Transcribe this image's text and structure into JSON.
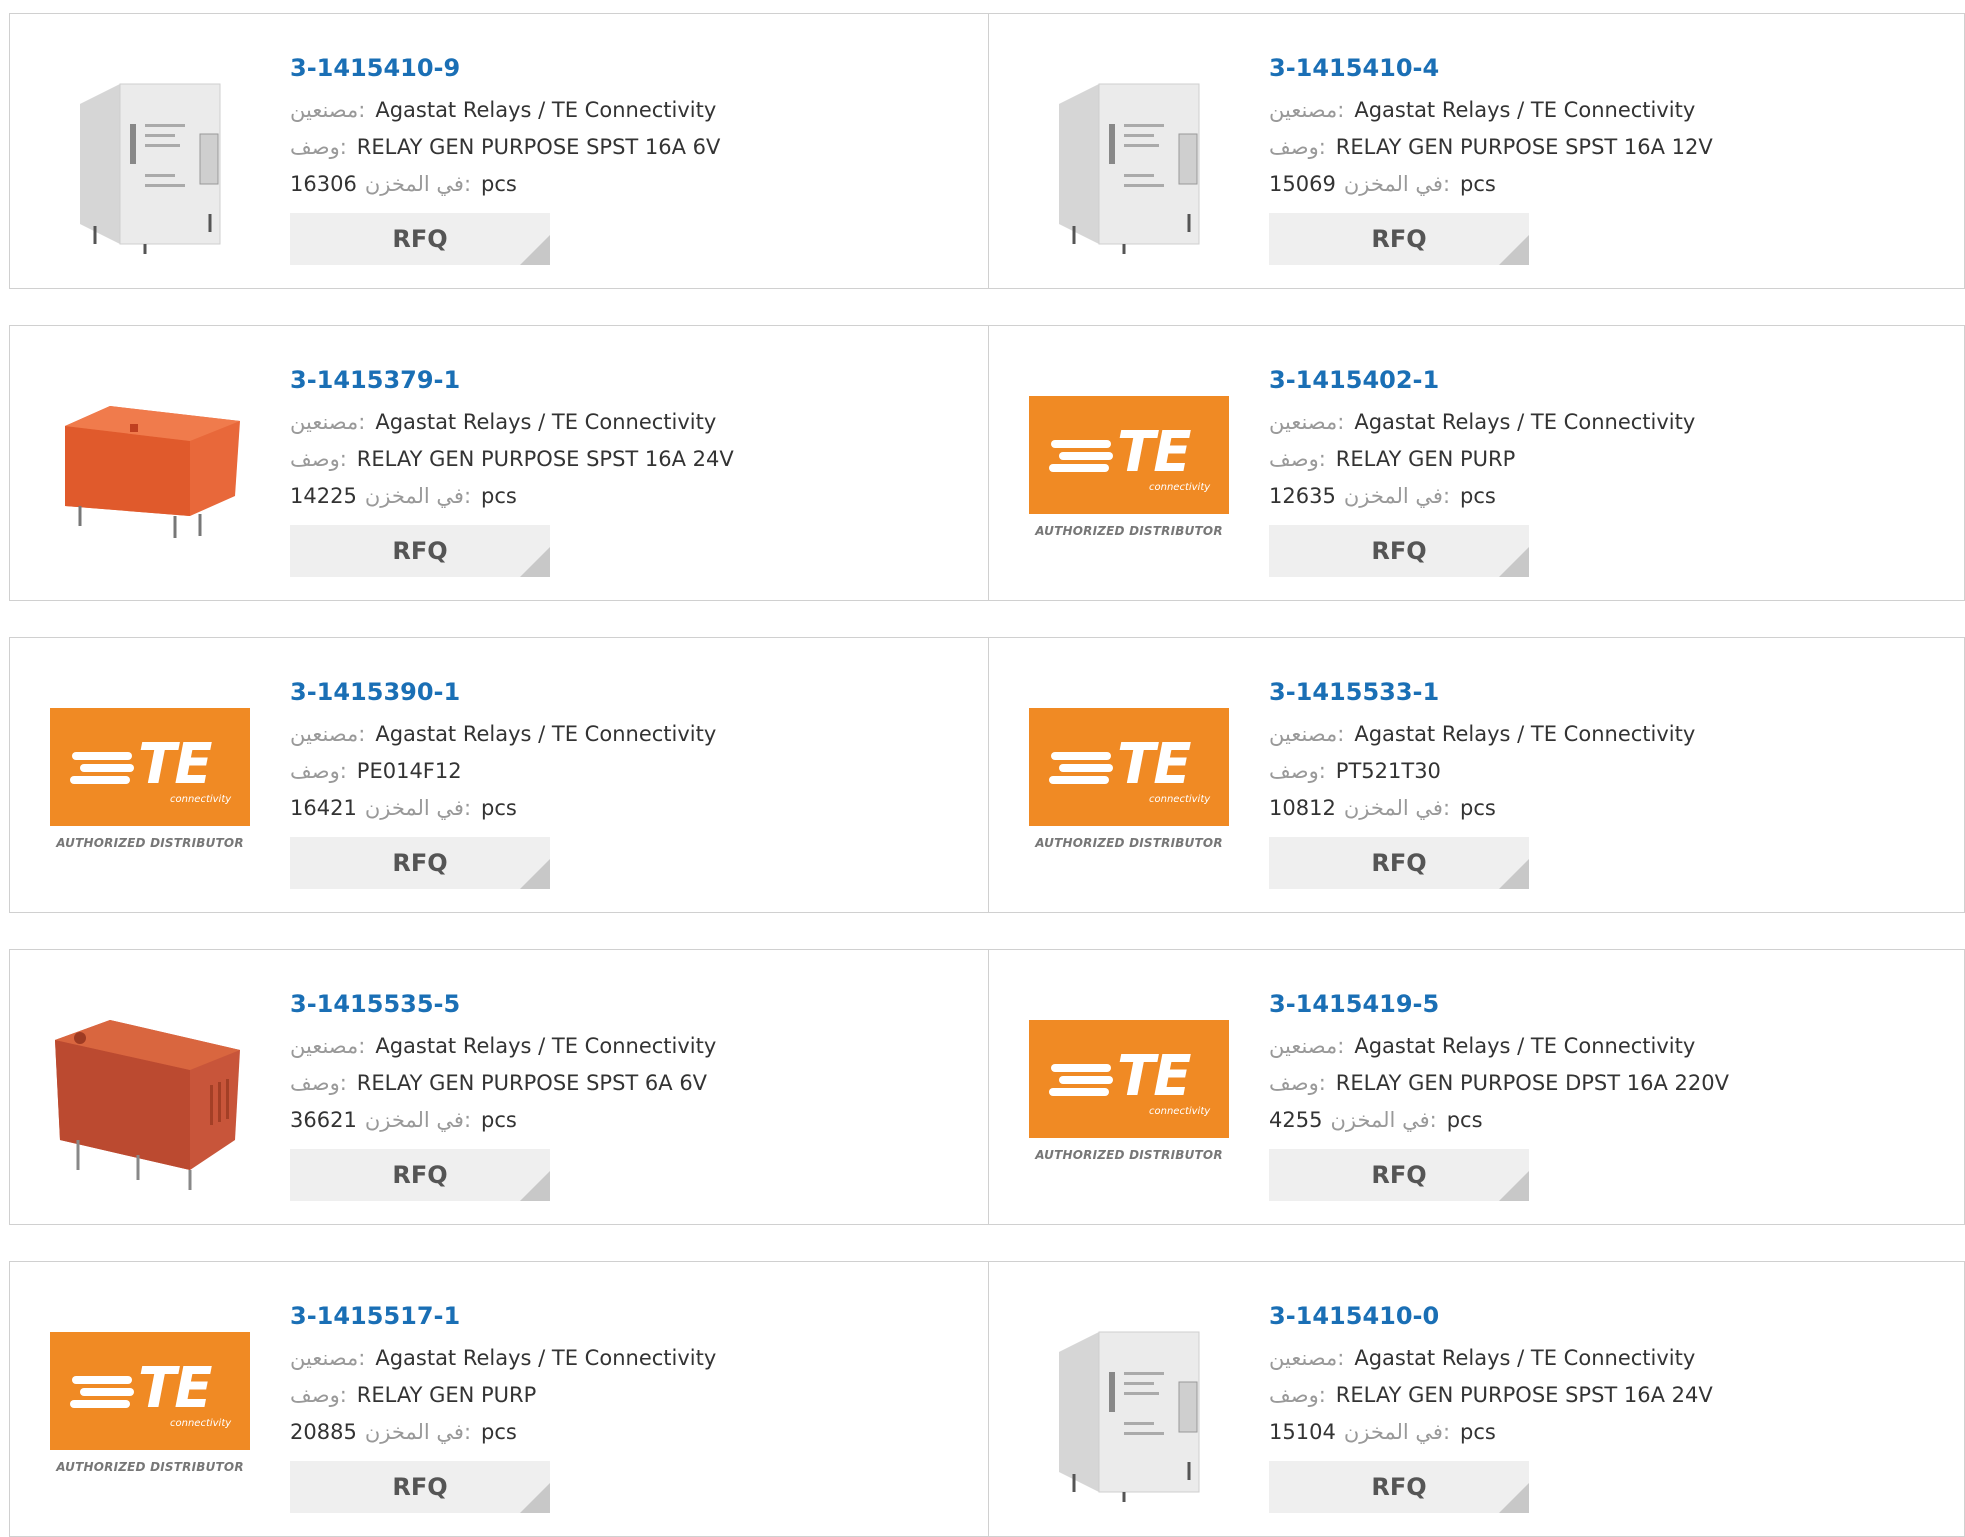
{
  "labels": {
    "manufacturer": "مصنعين:",
    "description": "وصف:",
    "in_stock": "في المخزن:",
    "unit": "pcs",
    "rfq": "RFQ"
  },
  "logo": {
    "brand": "TE",
    "sub": "connectivity",
    "authorized": "AUTHORIZED DISTRIBUTOR"
  },
  "colors": {
    "part_link": "#1a6fb5",
    "te_orange": "#f08a24",
    "relay_orange": "#e8683a"
  },
  "products": [
    {
      "part": "3-1415410-9",
      "manufacturer": "Agastat Relays / TE Connectivity",
      "description": "RELAY GEN PURPOSE SPST 16A 6V",
      "stock": "16306",
      "image": "white-relay-icon"
    },
    {
      "part": "3-1415410-4",
      "manufacturer": "Agastat Relays / TE Connectivity",
      "description": "RELAY GEN PURPOSE SPST 16A 12V",
      "stock": "15069",
      "image": "white-relay-icon"
    },
    {
      "part": "3-1415379-1",
      "manufacturer": "Agastat Relays / TE Connectivity",
      "description": "RELAY GEN PURPOSE SPST 16A 24V",
      "stock": "14225",
      "image": "orange-relay-icon"
    },
    {
      "part": "3-1415402-1",
      "manufacturer": "Agastat Relays / TE Connectivity",
      "description": "RELAY GEN PURP",
      "stock": "12635",
      "image": "te-logo"
    },
    {
      "part": "3-1415390-1",
      "manufacturer": "Agastat Relays / TE Connectivity",
      "description": "PE014F12",
      "stock": "16421",
      "image": "te-logo"
    },
    {
      "part": "3-1415533-1",
      "manufacturer": "Agastat Relays / TE Connectivity",
      "description": "PT521T30",
      "stock": "10812",
      "image": "te-logo"
    },
    {
      "part": "3-1415535-5",
      "manufacturer": "Agastat Relays / TE Connectivity",
      "description": "RELAY GEN PURPOSE SPST 6A 6V",
      "stock": "36621",
      "image": "red-relay-icon"
    },
    {
      "part": "3-1415419-5",
      "manufacturer": "Agastat Relays / TE Connectivity",
      "description": "RELAY GEN PURPOSE DPST 16A 220V",
      "stock": "4255",
      "image": "te-logo"
    },
    {
      "part": "3-1415517-1",
      "manufacturer": "Agastat Relays / TE Connectivity",
      "description": "RELAY GEN PURP",
      "stock": "20885",
      "image": "te-logo"
    },
    {
      "part": "3-1415410-0",
      "manufacturer": "Agastat Relays / TE Connectivity",
      "description": "RELAY GEN PURPOSE SPST 16A 24V",
      "stock": "15104",
      "image": "white-relay-icon"
    }
  ]
}
